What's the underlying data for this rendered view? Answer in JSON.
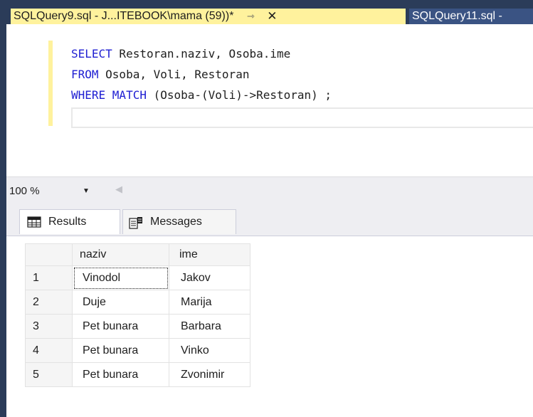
{
  "tabs": [
    {
      "title": "SQLQuery9.sql - J...ITEBOOK\\mama (59))*",
      "active": true
    },
    {
      "title": "SQLQuery11.sql -",
      "active": false
    }
  ],
  "icons": {
    "pin": "pin-icon",
    "close": "close-icon",
    "dropdown": "chevron-down-icon",
    "scroll_left": "scroll-left-icon",
    "results": "grid-icon",
    "messages": "messages-icon"
  },
  "editor": {
    "lines": [
      {
        "kw": "SELECT",
        "rest": " Restoran.naziv, Osoba.ime"
      },
      {
        "kw": "FROM",
        "rest": " Osoba, Voli, Restoran"
      },
      {
        "kw": "WHERE MATCH",
        "rest": " (Osoba-(Voli)->Restoran) ;"
      }
    ]
  },
  "zoom": {
    "value": "100 %"
  },
  "result_tabs": {
    "results": "Results",
    "messages": "Messages"
  },
  "grid": {
    "columns": [
      "naziv",
      "ime"
    ],
    "rows": [
      {
        "n": "1",
        "naziv": "Vinodol",
        "ime": "Jakov"
      },
      {
        "n": "2",
        "naziv": "Duje",
        "ime": "Marija"
      },
      {
        "n": "3",
        "naziv": "Pet bunara",
        "ime": "Barbara"
      },
      {
        "n": "4",
        "naziv": "Pet bunara",
        "ime": "Vinko"
      },
      {
        "n": "5",
        "naziv": "Pet bunara",
        "ime": "Zvonimir"
      }
    ]
  },
  "colors": {
    "frame": "#2b3c59",
    "active_tab": "#fff29d",
    "keyword": "#1e1ed2",
    "inactive_tab": "#3a5383"
  }
}
